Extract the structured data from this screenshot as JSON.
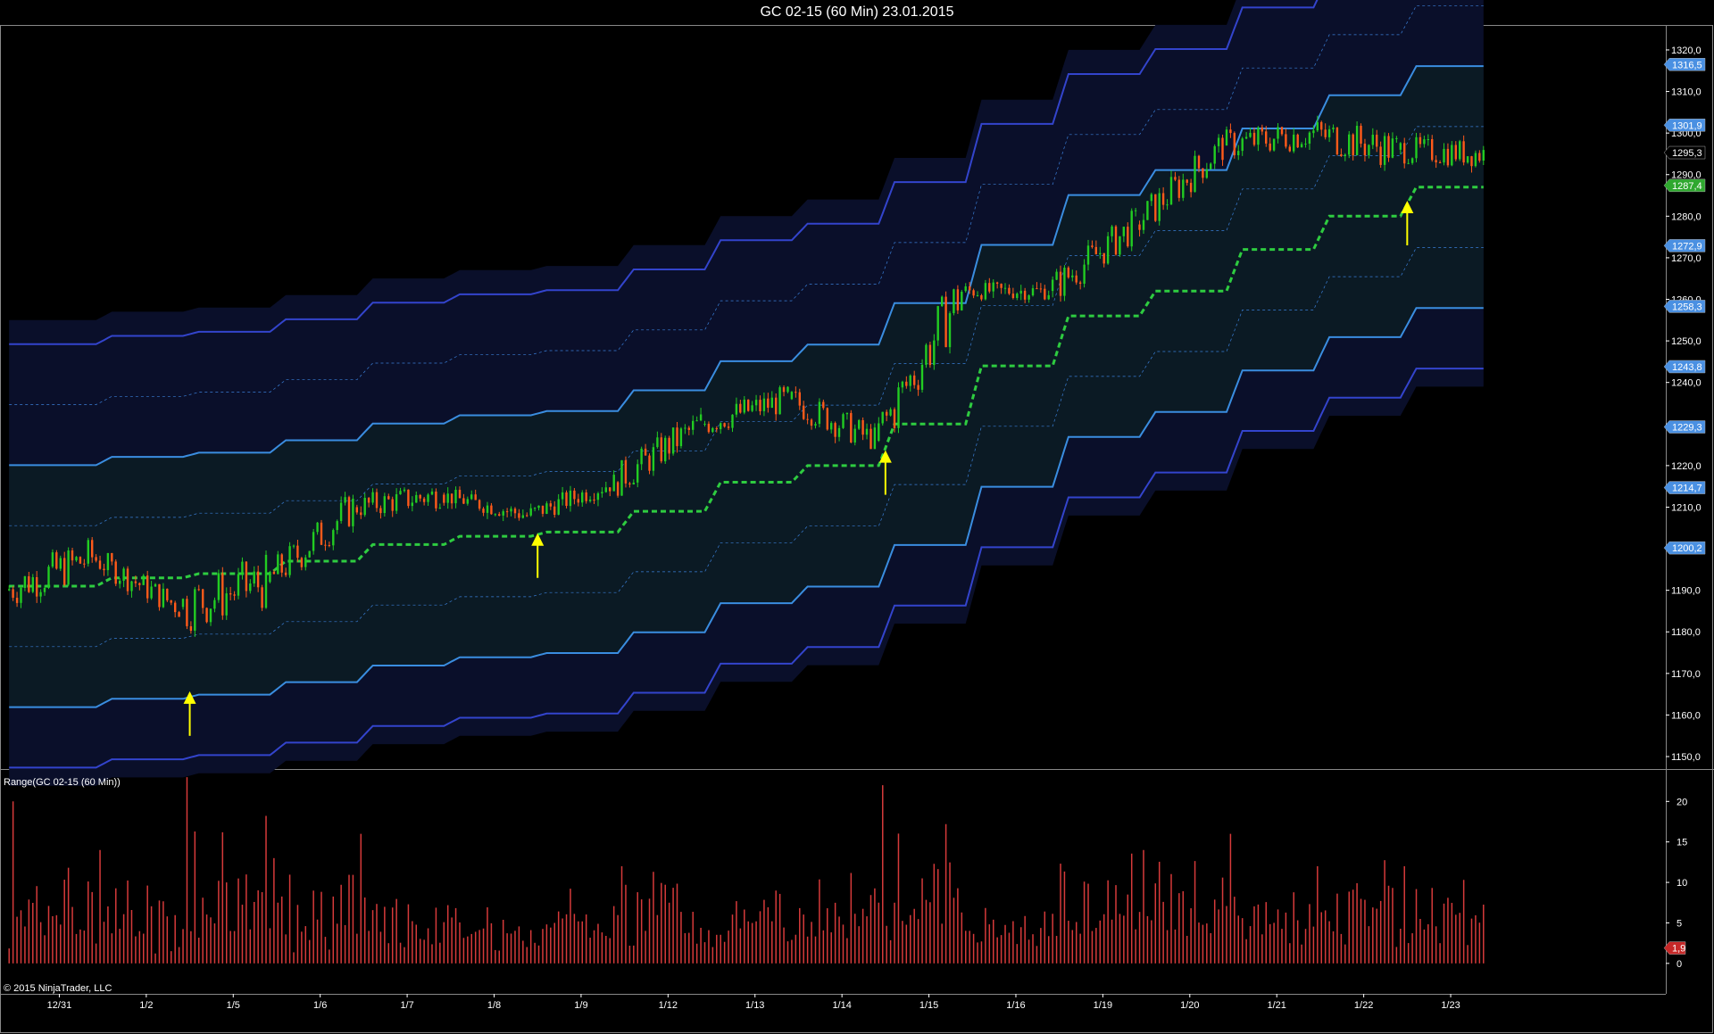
{
  "title": "GC 02-15 (60 Min)  23.01.2015",
  "copyright": "© 2015 NinjaTrader, LLC",
  "price_scale": {
    "ticks": [
      "1320,0",
      "1310,0",
      "1300,0",
      "1290,0",
      "1280,0",
      "1270,0",
      "1260,0",
      "1250,0",
      "1240,0",
      "1230,0",
      "1220,0",
      "1210,0",
      "1200,0",
      "1190,0",
      "1180,0",
      "1170,0",
      "1160,0",
      "1150,0"
    ],
    "tick_values": [
      1320,
      1310,
      1300,
      1290,
      1280,
      1270,
      1260,
      1250,
      1240,
      1230,
      1220,
      1210,
      1200,
      1190,
      1180,
      1170,
      1160,
      1150
    ]
  },
  "price_markers": [
    {
      "label": "1316,5",
      "value": 1316.5,
      "color": "#4a90e2"
    },
    {
      "label": "1301,9",
      "value": 1301.9,
      "color": "#4a90e2"
    },
    {
      "label": "1295,3",
      "value": 1295.3,
      "color": "#000000"
    },
    {
      "label": "1287,4",
      "value": 1287.4,
      "color": "#2fa82f"
    },
    {
      "label": "1272,9",
      "value": 1272.9,
      "color": "#4a90e2"
    },
    {
      "label": "1258,3",
      "value": 1258.3,
      "color": "#4a90e2"
    },
    {
      "label": "1243,8",
      "value": 1243.8,
      "color": "#4a90e2"
    },
    {
      "label": "1229,3",
      "value": 1229.3,
      "color": "#4a90e2"
    },
    {
      "label": "1214,7",
      "value": 1214.7,
      "color": "#4a90e2"
    },
    {
      "label": "1200,2",
      "value": 1200.2,
      "color": "#4a90e2"
    }
  ],
  "indicator_panel": {
    "label": "Range(GC 02-15 (60 Min))",
    "ticks": [
      "20",
      "15",
      "10",
      "5",
      "0"
    ],
    "tick_values": [
      20,
      15,
      10,
      5,
      0
    ],
    "last_value_label": "1,9",
    "last_value": 1.9
  },
  "x_axis_dates": [
    "12/31",
    "1/2",
    "1/5",
    "1/6",
    "1/7",
    "1/8",
    "1/9",
    "1/12",
    "1/13",
    "1/14",
    "1/15",
    "1/16",
    "1/19",
    "1/20",
    "1/21",
    "1/22",
    "1/23"
  ],
  "colors": {
    "background": "#000000",
    "up_candle": "#22cc22",
    "down_candle": "#ff5a1a",
    "mid_line": "#2ecc40",
    "band_light": "#3a8de0",
    "band_dark": "#3344cc",
    "range_bar": "#d63a3a",
    "arrow": "#ffff00"
  },
  "chart_data": {
    "type": "candlestick",
    "y_range": [
      1147,
      1326
    ],
    "range_y_range": [
      -2,
      24
    ],
    "sessions": [
      {
        "date": "12/31",
        "open": 1190,
        "close": 1198,
        "low": 1182,
        "high": 1210
      },
      {
        "date": "1/2",
        "open": 1198,
        "close": 1186,
        "low": 1180,
        "high": 1199
      },
      {
        "date": "1/5",
        "open": 1186,
        "close": 1192,
        "low": 1167,
        "high": 1205
      },
      {
        "date": "1/6",
        "open": 1192,
        "close": 1210,
        "low": 1190,
        "high": 1216
      },
      {
        "date": "1/7",
        "open": 1210,
        "close": 1213,
        "low": 1206,
        "high": 1224
      },
      {
        "date": "1/8",
        "open": 1213,
        "close": 1208,
        "low": 1203,
        "high": 1215
      },
      {
        "date": "1/9",
        "open": 1208,
        "close": 1216,
        "low": 1205,
        "high": 1219
      },
      {
        "date": "1/12",
        "open": 1216,
        "close": 1230,
        "low": 1212,
        "high": 1235
      },
      {
        "date": "1/13",
        "open": 1230,
        "close": 1236,
        "low": 1225,
        "high": 1245
      },
      {
        "date": "1/14",
        "open": 1236,
        "close": 1226,
        "low": 1224,
        "high": 1245
      },
      {
        "date": "1/15",
        "open": 1226,
        "close": 1262,
        "low": 1225,
        "high": 1266
      },
      {
        "date": "1/16",
        "open": 1262,
        "close": 1262,
        "low": 1256,
        "high": 1268
      },
      {
        "date": "1/19",
        "open": 1262,
        "close": 1278,
        "low": 1258,
        "high": 1282
      },
      {
        "date": "1/20",
        "open": 1278,
        "close": 1297,
        "low": 1275,
        "high": 1300
      },
      {
        "date": "1/21",
        "open": 1297,
        "close": 1300,
        "low": 1285,
        "high": 1307
      },
      {
        "date": "1/22",
        "open": 1300,
        "close": 1296,
        "low": 1282,
        "high": 1308
      },
      {
        "date": "1/23",
        "open": 1296,
        "close": 1295,
        "low": 1285,
        "high": 1304
      }
    ],
    "mid_line_by_session": [
      1191,
      1193,
      1194,
      1197,
      1201,
      1203,
      1204,
      1209,
      1216,
      1220,
      1230,
      1244,
      1256,
      1262,
      1272,
      1280,
      1287
    ],
    "band_step": 14.55,
    "signal_arrows": [
      "1/5",
      "1/9",
      "1/15",
      "1/23"
    ],
    "range_spikes": [
      {
        "date": "12/31",
        "value": 20
      },
      {
        "date": "1/2",
        "value": 14
      },
      {
        "date": "1/5",
        "value": 23
      },
      {
        "date": "1/6",
        "value": 13
      },
      {
        "date": "1/7",
        "value": 16
      },
      {
        "date": "1/12",
        "value": 12
      },
      {
        "date": "1/15",
        "value": 22
      },
      {
        "date": "1/20",
        "value": 14
      },
      {
        "date": "1/21",
        "value": 16
      },
      {
        "date": "1/22",
        "value": 12
      },
      {
        "date": "1/23",
        "value": 12
      }
    ]
  }
}
